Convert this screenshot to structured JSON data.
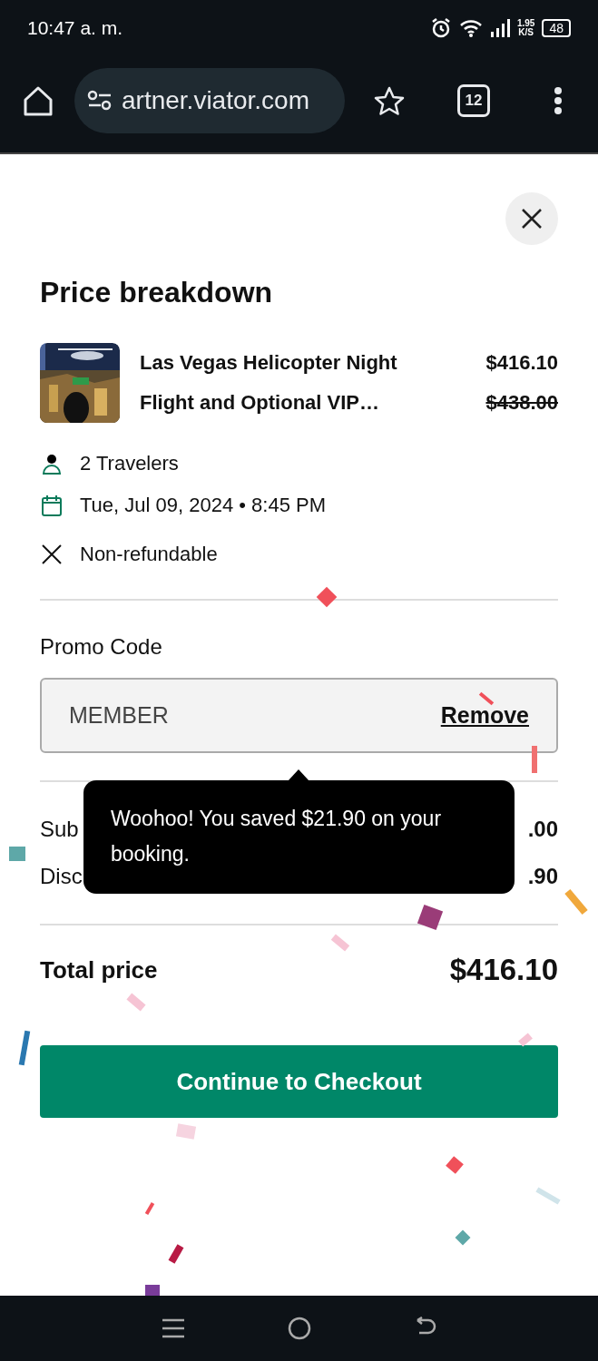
{
  "status_bar": {
    "time": "10:47 a. m.",
    "net_speed": "1.95",
    "net_unit": "K/S",
    "battery": "48"
  },
  "browser": {
    "url": "artner.viator.com",
    "tab_count": "12"
  },
  "sheet": {
    "title": "Price breakdown",
    "product": {
      "title": "Las Vegas Helicopter Night Flight and Optional VIP…",
      "price": "$416.10",
      "original_price": "$438.00"
    },
    "details": [
      {
        "kind": "person",
        "text": "2 Travelers"
      },
      {
        "kind": "calendar",
        "text": "Tue, Jul 09, 2024 • 8:45 PM"
      },
      {
        "kind": "cross",
        "text": "Non-refundable"
      }
    ],
    "promo": {
      "label": "Promo Code",
      "value": "MEMBER",
      "action": "Remove"
    },
    "summary": [
      {
        "label": "Sub",
        "value": ".00"
      },
      {
        "label": "Disc",
        "value": ".90"
      }
    ],
    "total": {
      "label": "Total price",
      "value": "$416.10"
    },
    "button": "Continue to Checkout",
    "tooltip": "Woohoo! You saved $21.90 on your booking."
  }
}
